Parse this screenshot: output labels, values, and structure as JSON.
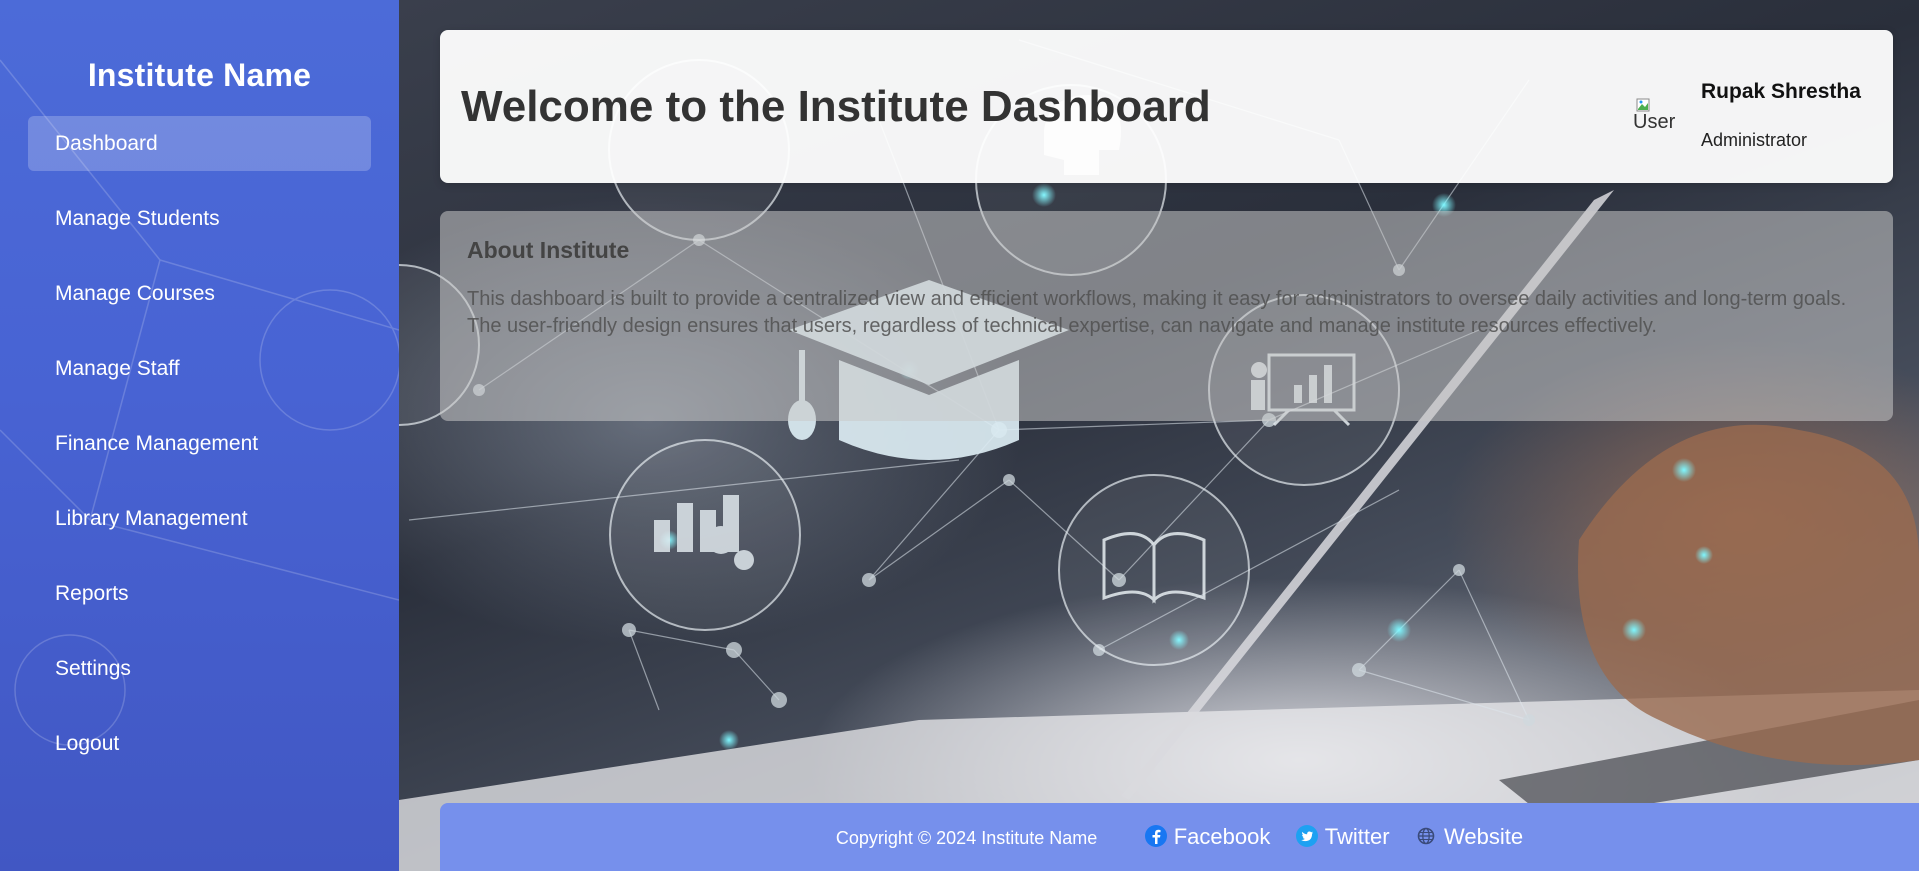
{
  "sidebar": {
    "title": "Institute Name",
    "items": [
      {
        "label": "Dashboard",
        "active": true
      },
      {
        "label": "Manage Students"
      },
      {
        "label": "Manage Courses"
      },
      {
        "label": "Manage Staff"
      },
      {
        "label": "Finance Management"
      },
      {
        "label": "Library Management"
      },
      {
        "label": "Reports"
      },
      {
        "label": "Settings"
      },
      {
        "label": "Logout"
      }
    ]
  },
  "header": {
    "title": "Welcome to the Institute Dashboard",
    "user": {
      "avatar_alt": "User",
      "name": "Rupak Shrestha",
      "role": "Administrator"
    }
  },
  "about": {
    "title": "About Institute",
    "text": "This dashboard is built to provide a centralized view and efficient workflows, making it easy for administrators to oversee daily activities and long-term goals. The user-friendly design ensures that users, regardless of technical expertise, can navigate and manage institute resources effectively."
  },
  "footer": {
    "copyright": "Copyright © 2024 Institute Name",
    "links": [
      {
        "label": "Facebook",
        "icon": "facebook-icon"
      },
      {
        "label": "Twitter",
        "icon": "twitter-icon"
      },
      {
        "label": "Website",
        "icon": "globe-icon"
      }
    ]
  },
  "colors": {
    "sidebar": "#4a66d5",
    "footer": "#7690ec",
    "title_text": "#333333"
  }
}
